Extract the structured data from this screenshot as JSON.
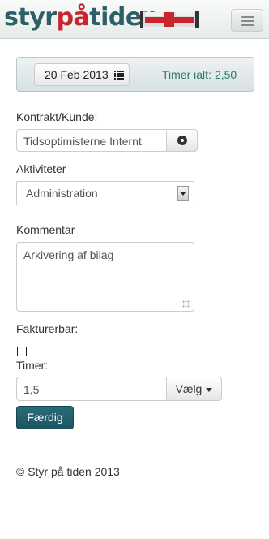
{
  "brand": {
    "logo_part1": "styr",
    "logo_part2": "på",
    "logo_part3": "tiden"
  },
  "navbar": {
    "menu_icon": "hamburger-icon"
  },
  "date_bar": {
    "date": "20 Feb 2013",
    "date_icon": "list-icon",
    "total_label": "Timer ialt:",
    "total_value": "2,50"
  },
  "form": {
    "contract_label": "Kontrakt/Kunde:",
    "contract_value": "Tidsoptimisterne Internt",
    "contract_button_icon": "circle-dot-icon",
    "activity_label": "Aktiviteter",
    "activity_value": "Administration",
    "comment_label": "Kommentar",
    "comment_value": "Arkivering af bilag",
    "billable_label": "Fakturerbar:",
    "billable_checked": false,
    "hours_label": "Timer:",
    "hours_value": "1,5",
    "hours_dropdown_label": "Vælg",
    "submit_label": "Færdig"
  },
  "footer": {
    "text": "© Styr på tiden 2013"
  },
  "colors": {
    "brand_teal": "#2c5f66",
    "brand_red": "#c8252c",
    "primary_button": "#1d5560",
    "total_text": "#2a7a70"
  }
}
